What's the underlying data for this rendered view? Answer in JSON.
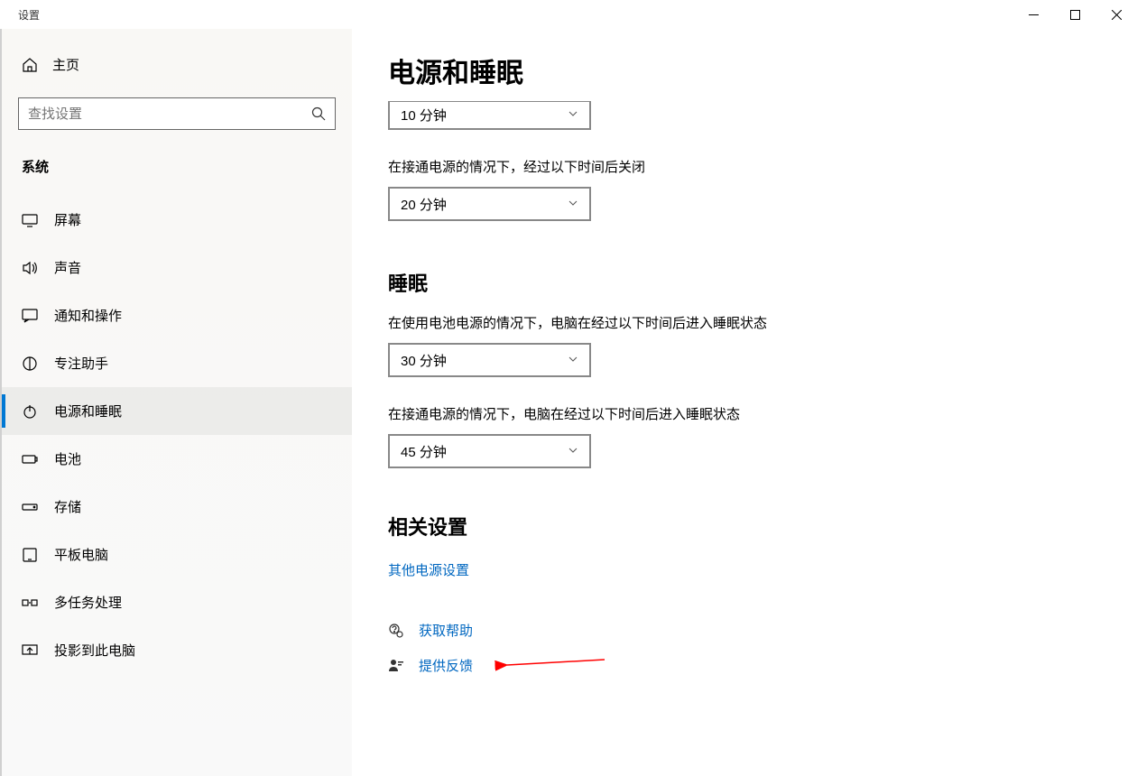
{
  "window": {
    "title": "设置"
  },
  "sidebar": {
    "home_label": "主页",
    "search_placeholder": "查找设置",
    "category_label": "系统",
    "items": [
      {
        "label": "屏幕",
        "icon": "display-icon"
      },
      {
        "label": "声音",
        "icon": "sound-icon"
      },
      {
        "label": "通知和操作",
        "icon": "notification-icon"
      },
      {
        "label": "专注助手",
        "icon": "focus-icon"
      },
      {
        "label": "电源和睡眠",
        "icon": "power-icon"
      },
      {
        "label": "电池",
        "icon": "battery-icon"
      },
      {
        "label": "存储",
        "icon": "storage-icon"
      },
      {
        "label": "平板电脑",
        "icon": "tablet-icon"
      },
      {
        "label": "多任务处理",
        "icon": "multitask-icon"
      },
      {
        "label": "投影到此电脑",
        "icon": "project-icon"
      }
    ],
    "active_index": 4
  },
  "main": {
    "title": "电源和睡眠",
    "screen_plugged_label": "在接通电源的情况下，经过以下时间后关闭",
    "screen_battery_value": "10 分钟",
    "screen_plugged_value": "20 分钟",
    "sleep_heading": "睡眠",
    "sleep_battery_label": "在使用电池电源的情况下，电脑在经过以下时间后进入睡眠状态",
    "sleep_battery_value": "30 分钟",
    "sleep_plugged_label": "在接通电源的情况下，电脑在经过以下时间后进入睡眠状态",
    "sleep_plugged_value": "45 分钟",
    "related_heading": "相关设置",
    "related_link": "其他电源设置",
    "help_link": "获取帮助",
    "feedback_link": "提供反馈"
  },
  "colors": {
    "accent": "#0078d4",
    "link": "#0067c0",
    "arrow": "#ff0000"
  }
}
